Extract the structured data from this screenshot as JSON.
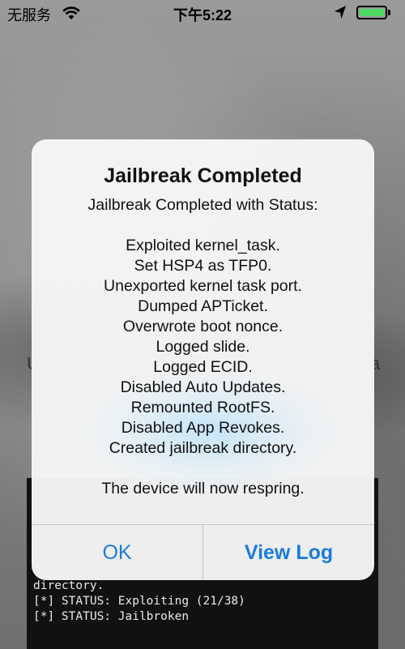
{
  "status_bar": {
    "carrier": "无服务",
    "time": "下午5:22",
    "battery_color": "#4cd964"
  },
  "background": {
    "left_char": "U",
    "right_char": "a"
  },
  "console": {
    "lines": [
      "directory.",
      "[*] STATUS: Exploiting (21/38)",
      "[*] STATUS: Jailbroken"
    ]
  },
  "alert": {
    "title": "Jailbreak Completed",
    "message_intro": "Jailbreak Completed with Status:",
    "status_lines": [
      "Exploited kernel_task.",
      "Set HSP4 as TFP0.",
      "Unexported kernel task port.",
      "Dumped APTicket.",
      "Overwrote boot nonce.",
      "Logged slide.",
      "Logged ECID.",
      "Disabled Auto Updates.",
      "Remounted RootFS.",
      "Disabled App Revokes.",
      "Created jailbreak directory."
    ],
    "footer": "The device will now respring.",
    "buttons": {
      "ok": "OK",
      "view_log": "View Log"
    },
    "accent_color": "#1a7bdc"
  }
}
